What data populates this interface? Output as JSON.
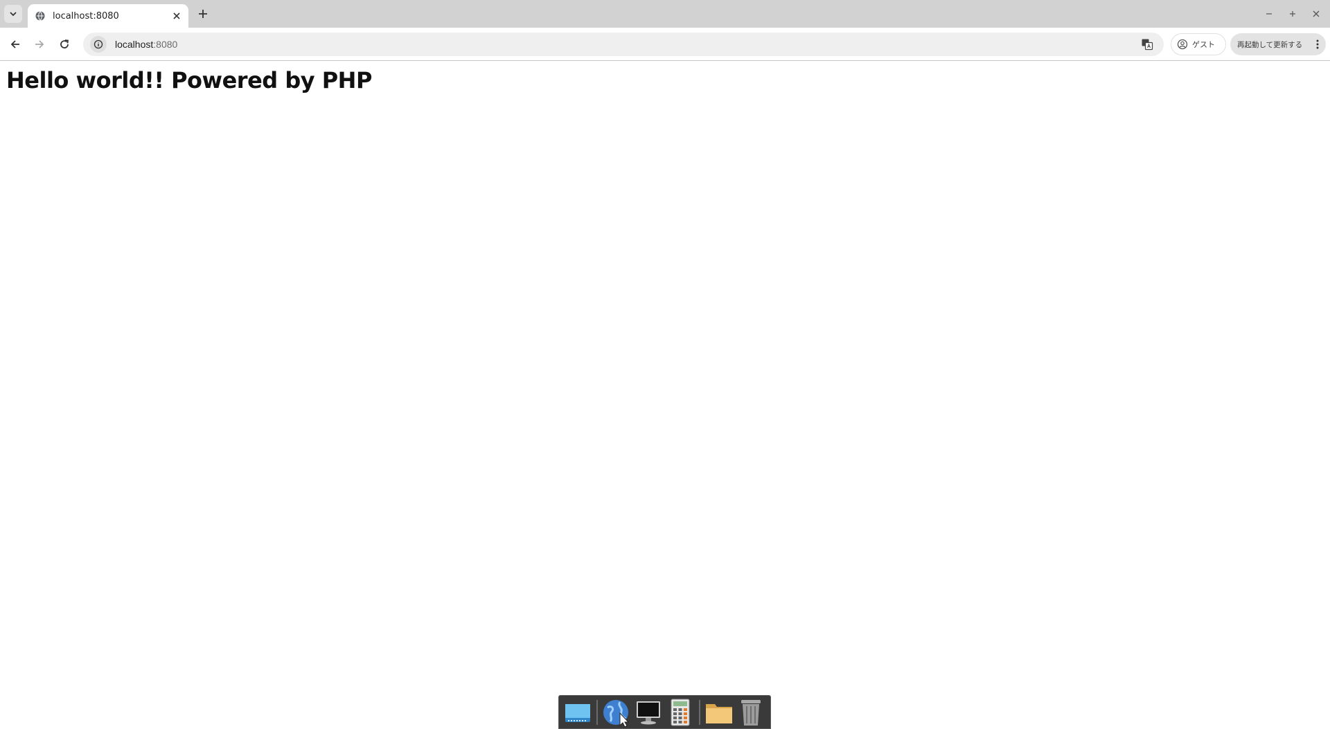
{
  "browser": {
    "tab": {
      "title": "localhost:8080"
    },
    "omnibox": {
      "host": "localhost",
      "port": ":8080"
    },
    "profile": {
      "label": "ゲスト"
    },
    "update": {
      "label": "再起動して更新する"
    }
  },
  "page": {
    "heading": "Hello world!! Powered by PHP"
  },
  "dock": {
    "items": [
      "desktop-icon",
      "web-browser-icon",
      "terminal-icon",
      "calculator-icon",
      "folder-icon",
      "trash-icon"
    ]
  },
  "colors": {
    "tabstrip": "#d2d2d2",
    "omnibox": "#efefef",
    "dock": "#3a3a3a"
  }
}
